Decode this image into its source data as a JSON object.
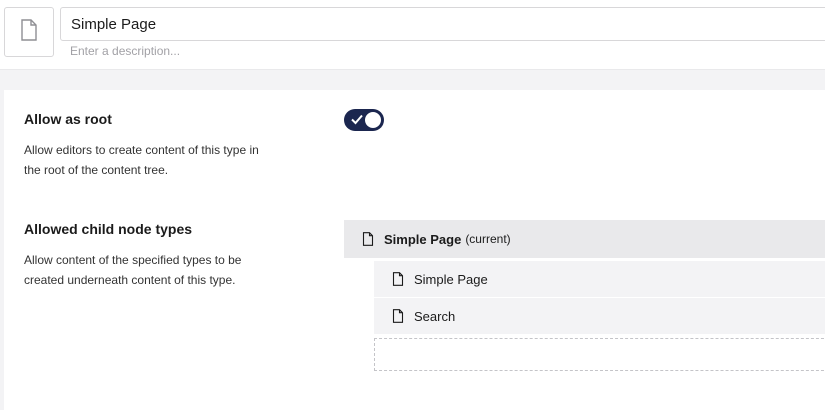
{
  "header": {
    "name_value": "Simple Page",
    "description_placeholder": "Enter a description...",
    "icon": "document-icon"
  },
  "allow_as_root": {
    "label": "Allow as root",
    "description": "Allow editors to create content of this type in the root of the content tree.",
    "enabled": true
  },
  "allowed_child_node_types": {
    "label": "Allowed child node types",
    "description": "Allow content of the specified types to be created underneath content of this type.",
    "current": {
      "name": "Simple Page",
      "suffix": "(current)",
      "icon": "document-icon"
    },
    "items": [
      {
        "name": "Simple Page",
        "icon": "document-icon"
      },
      {
        "name": "Search",
        "icon": "document-icon"
      }
    ]
  },
  "colors": {
    "accent": "#1b264f",
    "row_bg": "#f3f3f5",
    "current_row_bg": "#e9e9eb"
  }
}
